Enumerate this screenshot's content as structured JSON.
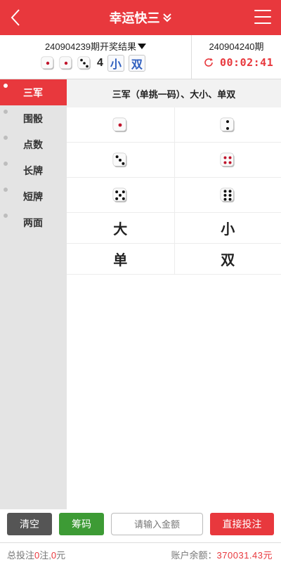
{
  "header": {
    "title": "幸运快三",
    "icons": {
      "back": "chevron-left-icon",
      "title_toggle": "double-chevron-down-icon",
      "menu": "hamburger-menu-icon"
    }
  },
  "last_draw": {
    "title": "240904239期开奖结果",
    "dice": [
      1,
      1,
      3
    ],
    "sum": "4",
    "size": "小",
    "parity": "双"
  },
  "next_draw": {
    "issue": "240904240期",
    "countdown": "00:02:41",
    "icons": {
      "refresh": "refresh-icon"
    }
  },
  "sidebar": {
    "items": [
      {
        "label": "三军",
        "active": true
      },
      {
        "label": "围骰",
        "active": false
      },
      {
        "label": "点数",
        "active": false
      },
      {
        "label": "长牌",
        "active": false
      },
      {
        "label": "短牌",
        "active": false
      },
      {
        "label": "两面",
        "active": false
      }
    ]
  },
  "bet_panel": {
    "section_title": "三军（单挑一码）、大小、单双",
    "dice_options": [
      1,
      2,
      3,
      4,
      5,
      6
    ],
    "text_options": [
      "大",
      "小",
      "单",
      "双"
    ]
  },
  "actions": {
    "clear": "清空",
    "chip": "筹码",
    "amount_placeholder": "请输入金额",
    "bet": "直接投注"
  },
  "footer": {
    "total_label": "总投注",
    "bet_count": "0",
    "count_unit": "注,",
    "amount": "0",
    "amount_unit": "元",
    "balance_label": "账户余额：",
    "balance": "370031.43元"
  },
  "colors": {
    "accent": "#e8383d",
    "chip_button": "#3d9b35",
    "clear_button": "#555555",
    "tag_text": "#2f5fbf",
    "sidebar_bg": "#e4e4e4"
  }
}
